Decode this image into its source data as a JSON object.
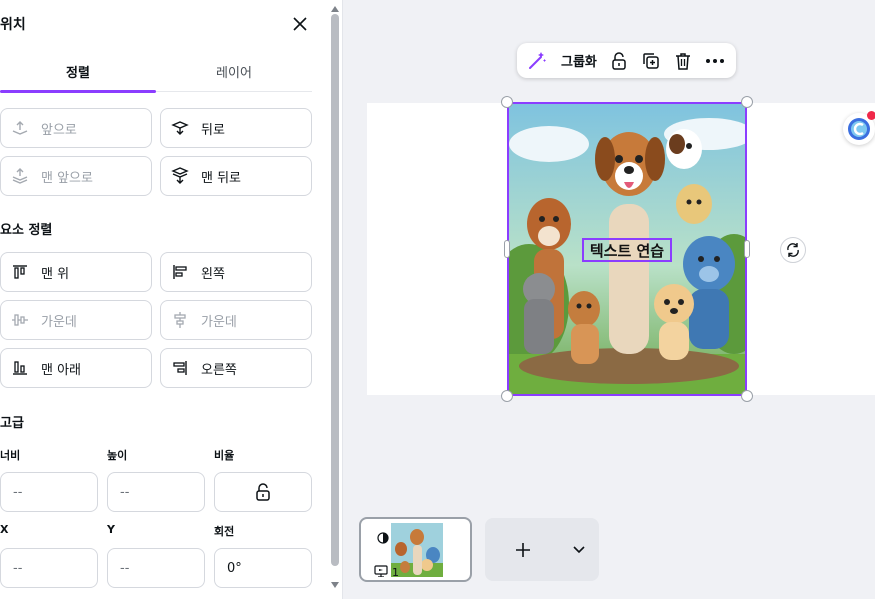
{
  "panel": {
    "title": "위치",
    "tabs": [
      {
        "label": "정렬",
        "active": true
      },
      {
        "label": "레이어",
        "active": false
      }
    ],
    "layer_buttons": {
      "forward": "앞으로",
      "backward": "뒤로",
      "to_front": "맨 앞으로",
      "to_back": "맨 뒤로"
    },
    "align_section": {
      "title": "요소 정렬",
      "top": "맨 위",
      "left": "왼쪽",
      "middle": "가운데",
      "center": "가운데",
      "bottom": "맨 아래",
      "right": "오른쪽"
    },
    "advanced": {
      "title": "고급",
      "width_label": "너비",
      "height_label": "높이",
      "ratio_label": "비율",
      "x_label": "X",
      "y_label": "Y",
      "rotation_label": "회전",
      "width_value": "--",
      "height_value": "--",
      "x_value": "--",
      "y_value": "--",
      "rotation_value": "0°"
    }
  },
  "toolbar": {
    "group_label": "그룹화"
  },
  "canvas": {
    "text_element": "텍스트 연습"
  },
  "pages": {
    "current_page_number": "1"
  },
  "colors": {
    "accent": "#8b3dff",
    "canvas_bg": "#f0f1f5",
    "notification_dot": "#f02849"
  }
}
